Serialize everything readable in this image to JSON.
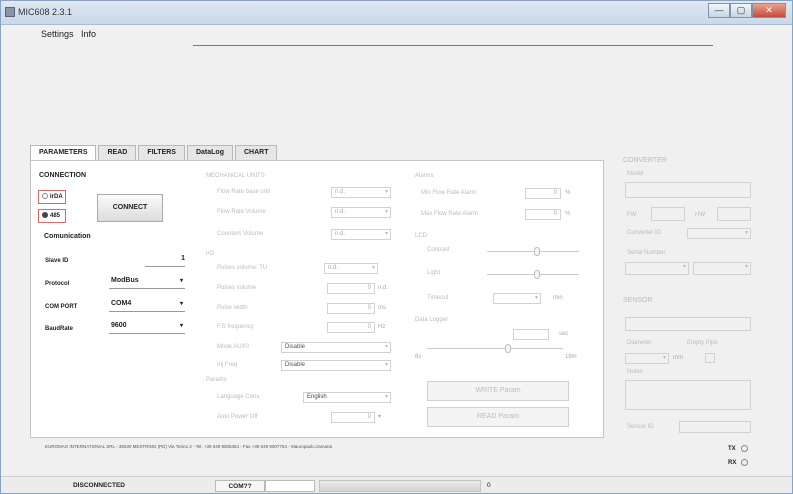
{
  "window": {
    "title": "MIC608 2.3.1",
    "controls": [
      "—",
      "▢",
      "✕"
    ]
  },
  "menu": [
    "Settings",
    "Info"
  ],
  "tabs": [
    "PARAMETERS",
    "READ",
    "FILTERS",
    "DataLog",
    "CHART"
  ],
  "connection": {
    "title": "CONNECTION",
    "irda": "IrDA",
    "rs485": "485",
    "connect": "CONNECT",
    "comm_title": "Comunication",
    "fields": [
      {
        "label": "Slave ID",
        "value": "1"
      },
      {
        "label": "Protocol",
        "value": "ModBus"
      },
      {
        "label": "COM PORT",
        "value": "COM4"
      },
      {
        "label": "BaudRate",
        "value": "9600"
      }
    ]
  },
  "mech": {
    "title": "MECHANICAL UNITS",
    "rows": [
      {
        "label": "Flow Rate base unit",
        "value": "n.d."
      },
      {
        "label": "Flow Rate Volume",
        "value": "n.d."
      },
      {
        "label": "Counters Volume",
        "value": "n.d."
      }
    ]
  },
  "io": {
    "title": "I/O",
    "pulse_row": {
      "label": "Pulses volume: TU",
      "value": "n.d."
    },
    "rows": [
      {
        "label": "Pulses volume",
        "value": "0",
        "unit": "n.d."
      },
      {
        "label": "Pulse width",
        "value": "0",
        "unit": "ms"
      },
      {
        "label": "F.S frequency",
        "value": "0",
        "unit": "Hz"
      }
    ],
    "mode_rows": [
      {
        "label": "Mode AUX0",
        "value": "Disable"
      },
      {
        "label": "Inj Freq",
        "value": "Disable"
      }
    ]
  },
  "params": {
    "title": "Params",
    "language_label": "Language Conv.",
    "language_value": "English",
    "autopower_label": "Auto Power Off",
    "autopower_value": "0"
  },
  "alarms": {
    "title": "Alarms",
    "rows": [
      {
        "label": "Min Flow Rate Alarm",
        "value": "0",
        "unit": "%"
      },
      {
        "label": "Max Flow Rate Alarm",
        "value": "0",
        "unit": "%"
      }
    ]
  },
  "lcd": {
    "title": "LCD",
    "contrast": "Contrast",
    "light": "Light",
    "timeout": "Timeout",
    "timeout_unit": "min",
    "contrast_level": 0.55,
    "light_level": 0.55
  },
  "datalogger": {
    "title": "Data Logger",
    "unit": "sec",
    "min": "8s",
    "max": "18m",
    "level": 0.6
  },
  "buttons": {
    "write": "WRITE Param",
    "read": "READ Param"
  },
  "converter": {
    "title": "CONVERTER",
    "model": "Model",
    "fw": "FW",
    "hw": "HW",
    "converter_id": "Converter ID",
    "serial": "Serial Number"
  },
  "sensor": {
    "title": "SENSOR",
    "diameter": "Diameter",
    "empty_pipe": "Empty Pipe",
    "diam_unit": "mm",
    "notes": "Notes",
    "sensor_id": "Sensor ID"
  },
  "footer": {
    "company": "EUROMAG INTERNATIONAL SRL - 35030 MESTRINO (PD) Via Torino 2 - Tel. +39 049 9005354 - Fax +39 049 9007764 - Mauropaolo.zamana"
  },
  "leds": {
    "tx": "TX",
    "rx": "RX"
  },
  "status": {
    "state": "DISCONNECTED",
    "port": "COM??",
    "progress_value": "0"
  }
}
